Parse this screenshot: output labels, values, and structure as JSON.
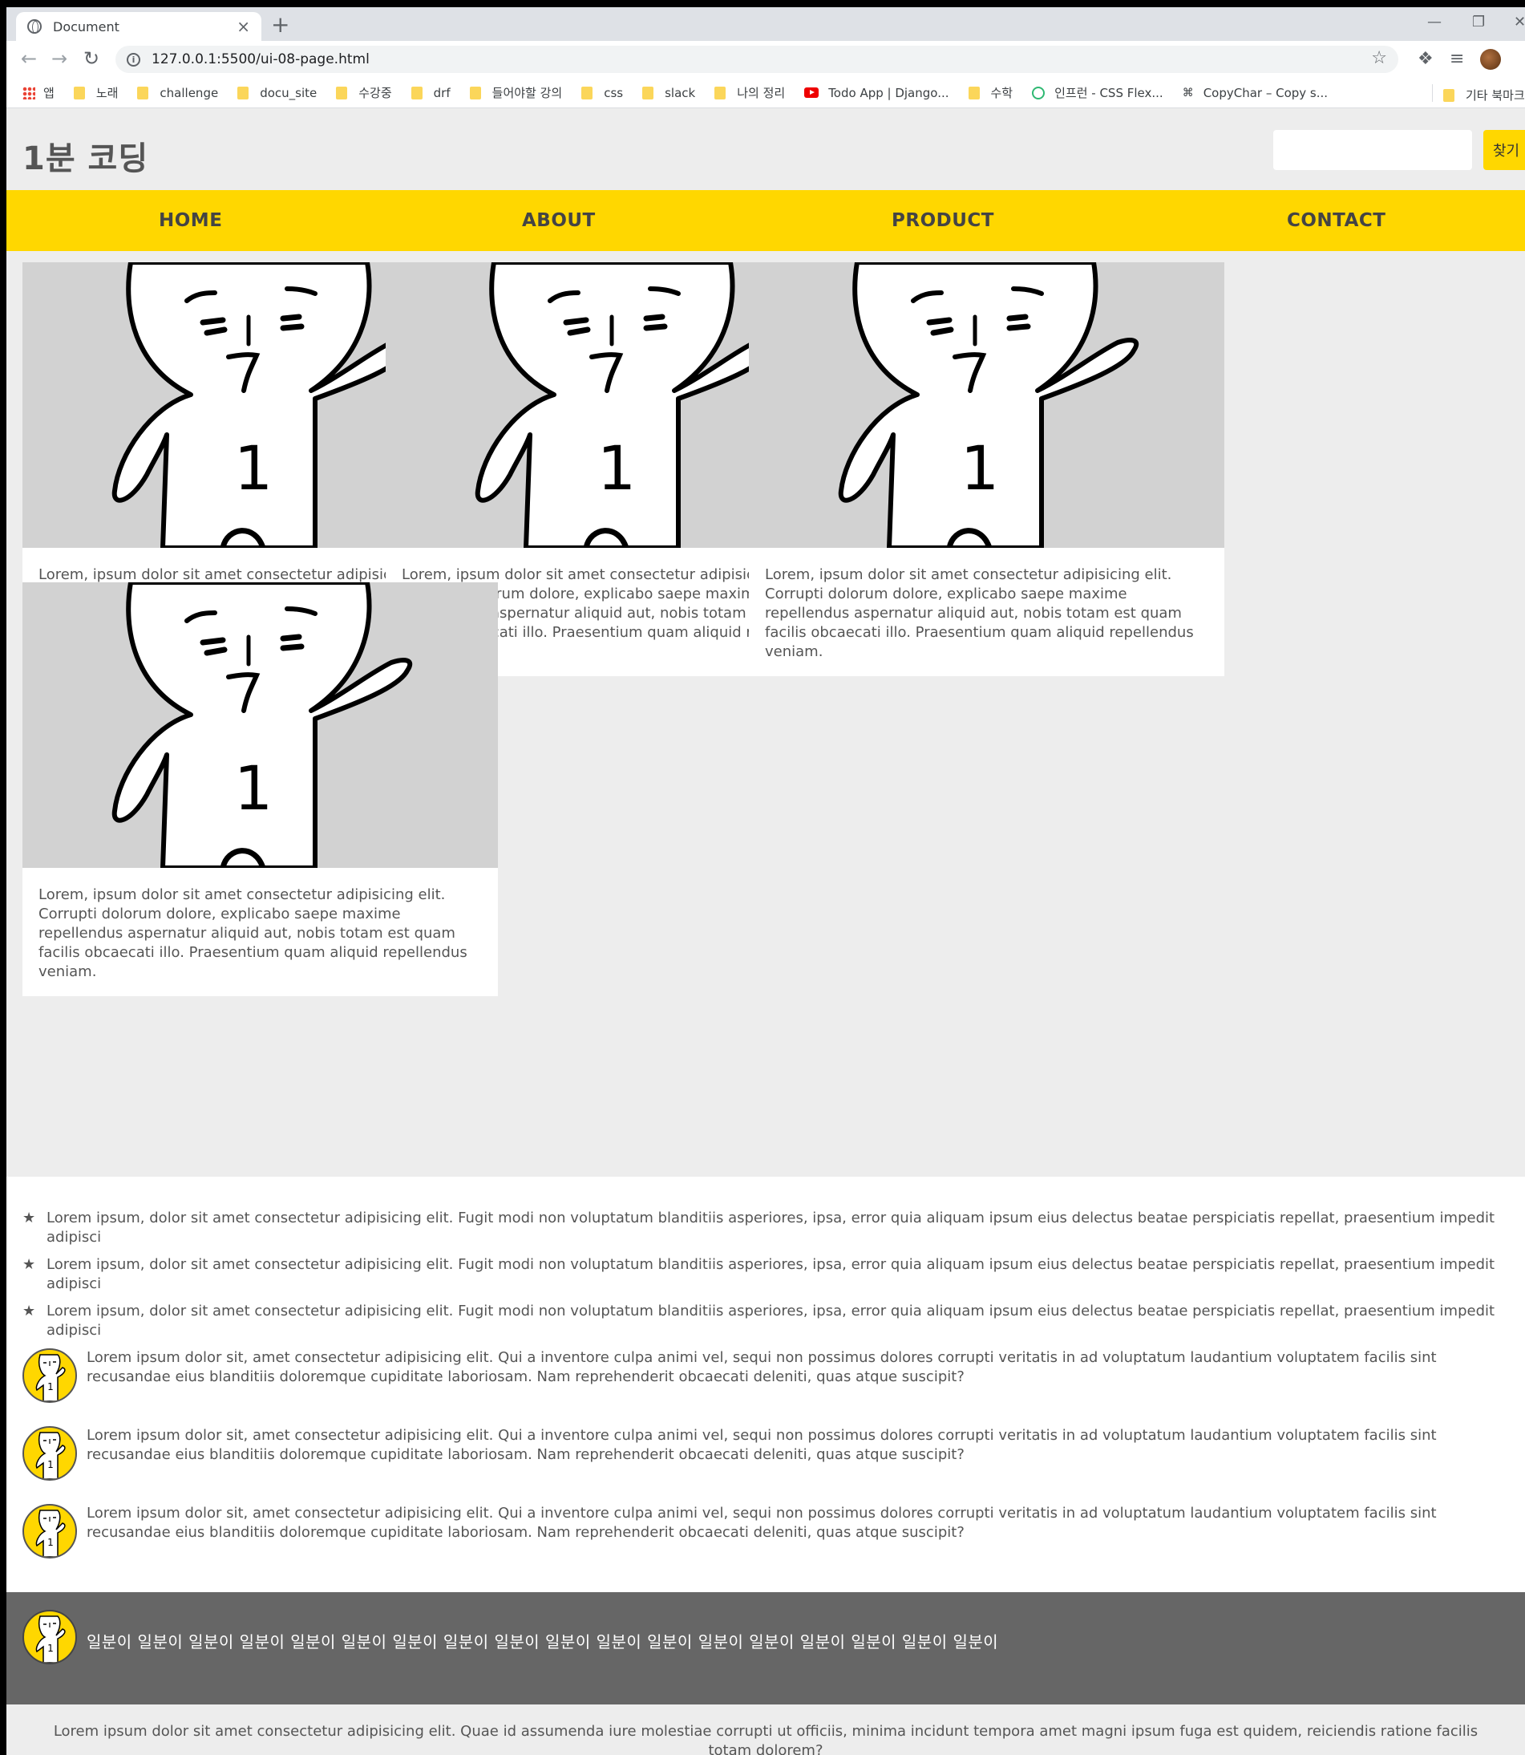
{
  "browser": {
    "tab_title": "Document",
    "tab_close": "×",
    "new_tab": "+",
    "url": "127.0.0.1:5500/ui-08-page.html",
    "bookmarks": [
      {
        "label": "앱",
        "icon": "apps-icon"
      },
      {
        "label": "노래",
        "icon": "folder-icon"
      },
      {
        "label": "challenge",
        "icon": "folder-icon"
      },
      {
        "label": "docu_site",
        "icon": "folder-icon"
      },
      {
        "label": "수강중",
        "icon": "folder-icon"
      },
      {
        "label": "drf",
        "icon": "folder-icon"
      },
      {
        "label": "들어야할 강의",
        "icon": "folder-icon"
      },
      {
        "label": "css",
        "icon": "folder-icon"
      },
      {
        "label": "slack",
        "icon": "folder-icon"
      },
      {
        "label": "나의 정리",
        "icon": "folder-icon"
      },
      {
        "label": "Todo App | Django...",
        "icon": "youtube-icon"
      },
      {
        "label": "수학",
        "icon": "folder-icon"
      },
      {
        "label": "인프런 - CSS Flex...",
        "icon": "inflearn-icon"
      },
      {
        "label": "CopyChar – Copy s...",
        "icon": "copychar-icon"
      }
    ],
    "other_bookmarks": "기타 북마크"
  },
  "header": {
    "logo": "1분 코딩",
    "search_placeholder": "",
    "search_button": "찾기"
  },
  "nav": {
    "items": [
      "HOME",
      "ABOUT",
      "PRODUCT",
      "CONTACT"
    ]
  },
  "cards": [
    {
      "text": "Lorem, ipsum dolor sit amet consectetur adipisicing elit. Corrupti dolorum dolore, explicabo saepe maxime repellendus aspernatur aliquid aut, nobis totam est quam facilis obcaecati illo. Praesentium quam aliquid repellendus veniam.",
      "image_label": "1"
    },
    {
      "text": "Lorem, ipsum dolor sit amet consectetur adipisicing elit. Corrupti dolorum dolore, explicabo saepe maxime repellendus aspernatur aliquid aut, nobis totam est quam facilis obcaecati illo. Praesentium quam aliquid repellendus veniam.",
      "image_label": "1"
    },
    {
      "text": "Lorem, ipsum dolor sit amet consectetur adipisicing elit. Corrupti dolorum dolore, explicabo saepe maxime repellendus aspernatur aliquid aut, nobis totam est quam facilis obcaecati illo. Praesentium quam aliquid repellendus veniam.",
      "image_label": "1"
    },
    {
      "text": "Lorem, ipsum dolor sit amet consectetur adipisicing elit. Corrupti dolorum dolore, explicabo saepe maxime repellendus aspernatur aliquid aut, nobis totam est quam facilis obcaecati illo. Praesentium quam aliquid repellendus veniam.",
      "image_label": "1"
    }
  ],
  "star_list": {
    "icon": "★",
    "items": [
      "Lorem ipsum, dolor sit amet consectetur adipisicing elit. Fugit modi non voluptatum blanditiis asperiores, ipsa, error quia aliquam ipsum eius delectus beatae perspiciatis repellat, praesentium impedit adipisci",
      "Lorem ipsum, dolor sit amet consectetur adipisicing elit. Fugit modi non voluptatum blanditiis asperiores, ipsa, error quia aliquam ipsum eius delectus beatae perspiciatis repellat, praesentium impedit adipisci",
      "Lorem ipsum, dolor sit amet consectetur adipisicing elit. Fugit modi non voluptatum blanditiis asperiores, ipsa, error quia aliquam ipsum eius delectus beatae perspiciatis repellat, praesentium impedit adipisci"
    ]
  },
  "avatar_list": {
    "items": [
      "Lorem ipsum dolor sit, amet consectetur adipisicing elit. Qui a inventore culpa animi vel, sequi non possimus dolores corrupti veritatis in ad voluptatum laudantium voluptatem facilis sint recusandae eius blanditiis doloremque cupiditate laboriosam. Nam reprehenderit obcaecati deleniti, quas atque suscipit?",
      "Lorem ipsum dolor sit, amet consectetur adipisicing elit. Qui a inventore culpa animi vel, sequi non possimus dolores corrupti veritatis in ad voluptatum laudantium voluptatem facilis sint recusandae eius blanditiis doloremque cupiditate laboriosam. Nam reprehenderit obcaecati deleniti, quas atque suscipit?",
      "Lorem ipsum dolor sit, amet consectetur adipisicing elit. Qui a inventore culpa animi vel, sequi non possimus dolores corrupti veritatis in ad voluptatum laudantium voluptatem facilis sint recusandae eius blanditiis doloremque cupiditate laboriosam. Nam reprehenderit obcaecati deleniti, quas atque suscipit?"
    ]
  },
  "footer": {
    "text": "일분이 일분이 일분이 일분이 일분이 일분이 일분이 일분이 일분이 일분이 일분이 일분이 일분이 일분이 일분이 일분이 일분이 일분이"
  },
  "bottom": {
    "text": "Lorem ipsum dolor sit amet consectetur adipisicing elit. Quae id assumenda iure molestiae corrupti ut officiis, minima incidunt tempora amet magni ipsum fuga est quidem, reiciendis ratione facilis totam dolorem?"
  },
  "colors": {
    "accent": "#ffd700",
    "page_bg": "#ededed",
    "footer_bg": "#666666",
    "image_bg": "#d2d2d2",
    "text": "#555555"
  }
}
